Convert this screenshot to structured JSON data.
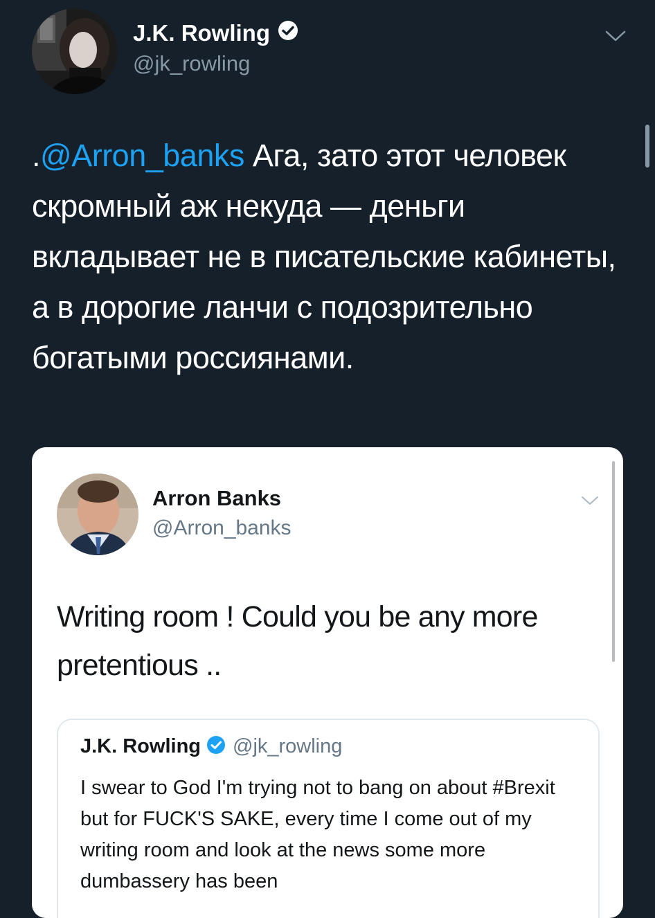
{
  "main_tweet": {
    "author_name": "J.K. Rowling",
    "author_handle": "@jk_rowling",
    "text_prefix": ".",
    "mention": "@Arron_banks",
    "text_body": " Ага, зато этот человек скромный аж некуда — деньги вкладывает не в писательские кабинеты, а в дорогие ланчи с подозрительно богатыми россиянами.",
    "icons": {
      "verified": "verified-badge-icon",
      "menu": "chevron-down-icon"
    },
    "colors": {
      "background": "#15202b",
      "mention": "#1da1f2",
      "secondary_text": "#8899a6"
    }
  },
  "embedded_screenshot": {
    "author_name": "Arron Banks",
    "author_handle": "@Arron_banks",
    "text": "Writing room ! Could you be any more pretentious ..",
    "quoted_tweet": {
      "author_name": "J.K. Rowling",
      "author_handle": "@jk_rowling",
      "text": "I swear to God I'm trying not to bang on about #Brexit but for FUCK'S SAKE, every time I come out of my writing room and look at the news some more dumbassery has been"
    }
  }
}
